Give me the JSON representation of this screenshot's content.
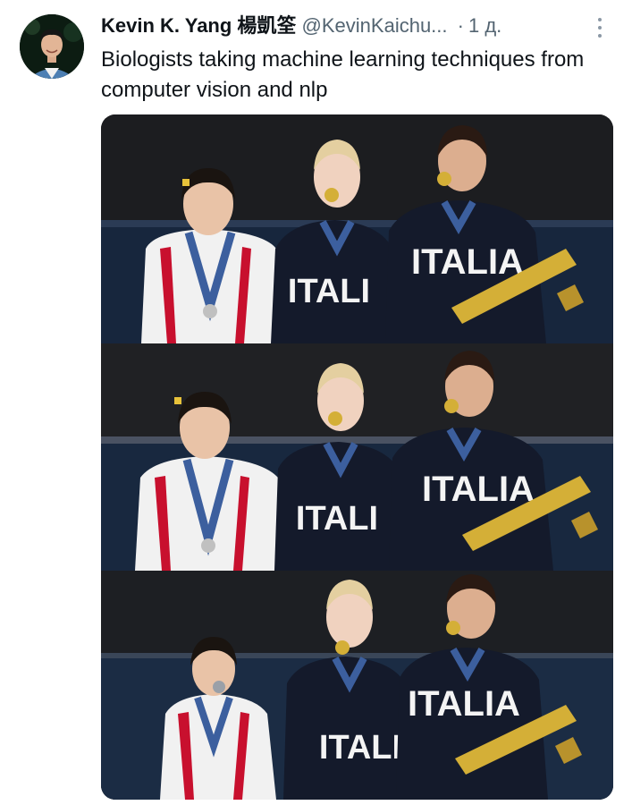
{
  "tweet": {
    "author_name": "Kevin K. Yang 楊凱筌",
    "handle": "@KevinKaichu...",
    "separator": "·",
    "time": "1 д.",
    "text": "Biologists taking machine learning techniques from computer vision and nlp"
  },
  "media": {
    "panels": [
      {
        "id": "panel-1",
        "shirt_text": "ITALIA",
        "front_shirt_text": "ITALI"
      },
      {
        "id": "panel-2",
        "shirt_text": "ITALIA",
        "front_shirt_text": "ITALI"
      },
      {
        "id": "panel-3",
        "shirt_text": "ITALIA",
        "front_shirt_text": "ITALI"
      }
    ]
  },
  "colors": {
    "text_primary": "#0f1419",
    "text_secondary": "#536471",
    "jacket_red": "#c8102e",
    "jacket_navy": "#141a2b",
    "medal_ribbon": "#3c5f9e",
    "gold": "#d4af37"
  },
  "icons": {
    "more": "more-dots-vertical-icon"
  }
}
